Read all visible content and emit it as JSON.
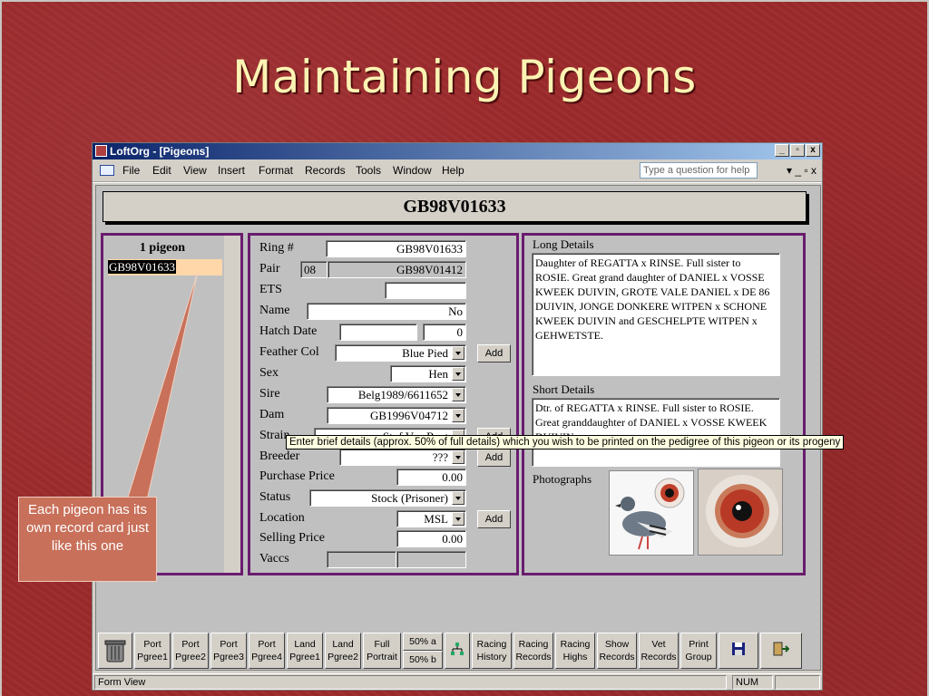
{
  "slide": {
    "title": "Maintaining Pigeons"
  },
  "window": {
    "title": "LoftOrg - [Pigeons]",
    "buttons": {
      "minimize": "_",
      "restore": "▫",
      "close": "x"
    }
  },
  "menu": {
    "items": [
      "File",
      "Edit",
      "View",
      "Insert",
      "Format",
      "Records",
      "Tools",
      "Window",
      "Help"
    ],
    "ask_placeholder": "Type a question for help",
    "right_controls": "▾  _  ▫  x"
  },
  "form": {
    "header": "GB98V01633",
    "list": {
      "count_label": "1 pigeon",
      "selected": "GB98V01633"
    },
    "fields": {
      "ring_label": "Ring #",
      "ring_value": "GB98V01633",
      "pair_label": "Pair",
      "pair_number": "08",
      "pair_value": "GB98V01412",
      "ets_label": "ETS",
      "ets_value": "",
      "name_label": "Name",
      "name_value": "No",
      "hatch_label": "Hatch Date",
      "hatch_value": "",
      "hatch_num": "0",
      "feather_label": "Feather Col",
      "feather_value": "Blue Pied",
      "sex_label": "Sex",
      "sex_value": "Hen",
      "sire_label": "Sire",
      "sire_value": "Belg1989/6611652",
      "dam_label": "Dam",
      "dam_value": "GB1996V04712",
      "strain_label": "Strain",
      "strain_value": "Stof Van Reet",
      "breeder_label": "Breeder",
      "breeder_value": "???",
      "purchase_label": "Purchase Price",
      "purchase_value": "0.00",
      "status_label": "Status",
      "status_value": "Stock (Prisoner)",
      "location_label": "Location",
      "location_value": "MSL",
      "selling_label": "Selling Price",
      "selling_value": "0.00",
      "vaccs_label": "Vaccs",
      "vaccs_value": ""
    },
    "add_label": "Add",
    "long_details_label": "Long Details",
    "long_details": "Daughter of REGATTA x RINSE. Full sister to ROSIE. Great grand daughter of DANIEL x VOSSE KWEEK DUIVIN, GROTE VALE DANIEL x DE 86 DUIVIN, JONGE DONKERE WITPEN x SCHONE KWEEK DUIVIN and GESCHELPTE WITPEN x GEHWETSTE.",
    "short_details_label": "Short Details",
    "short_details": "Dtr. of REGATTA x RINSE. Full sister to ROSIE. Great granddaughter of DANIEL x VOSSE KWEEK DUIVIN",
    "photographs_label": "Photographs",
    "tooltip": "Enter brief details (approx. 50% of full details) which you wish to be printed on the pedigree of this pigeon or its progeny"
  },
  "toolbar": [
    {
      "l1": "Port",
      "l2": "Pgree1"
    },
    {
      "l1": "Port",
      "l2": "Pgree2"
    },
    {
      "l1": "Port",
      "l2": "Pgree3"
    },
    {
      "l1": "Port",
      "l2": "Pgree4"
    },
    {
      "l1": "Land",
      "l2": "Pgree1"
    },
    {
      "l1": "Land",
      "l2": "Pgree2"
    },
    {
      "l1": "Full",
      "l2": "Portrait"
    },
    {
      "l1": "50% a",
      "l2": "50% b"
    },
    {
      "l1": "Racing",
      "l2": "History"
    },
    {
      "l1": "Racing",
      "l2": "Records"
    },
    {
      "l1": "Racing",
      "l2": "Highs"
    },
    {
      "l1": "Show",
      "l2": "Records"
    },
    {
      "l1": "Vet",
      "l2": "Records"
    },
    {
      "l1": "Print",
      "l2": "Group"
    }
  ],
  "status": {
    "left": "Form View",
    "num": "NUM"
  },
  "callout": {
    "text": "Each pigeon has its own record card just like this one"
  },
  "colors": {
    "background": "#9b2a2c",
    "title": "#fbf3b3",
    "panel_border": "#6a1c6e",
    "callout": "#c8705a"
  }
}
